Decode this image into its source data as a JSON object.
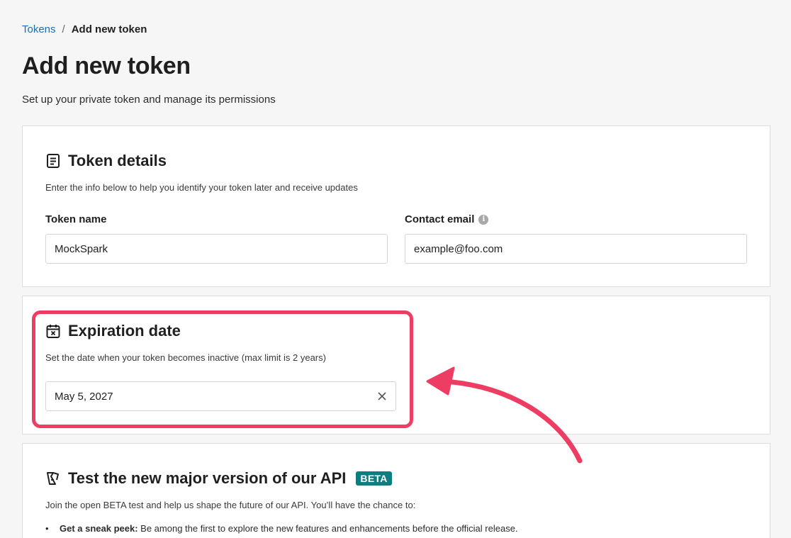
{
  "breadcrumb": {
    "parent": "Tokens",
    "separator": "/",
    "current": "Add new token"
  },
  "page": {
    "title": "Add new token",
    "subtitle": "Set up your private token and manage its permissions"
  },
  "token_details": {
    "icon": "document-icon",
    "title": "Token details",
    "description": "Enter the info below to help you identify your token later and receive updates",
    "token_name_label": "Token name",
    "token_name_value": "MockSpark",
    "contact_email_label": "Contact email",
    "contact_email_value": "example@foo.com"
  },
  "expiration": {
    "icon": "calendar-x-icon",
    "title": "Expiration date",
    "description": "Set the date when your token becomes inactive (max limit is 2 years)",
    "date_value": "May 5, 2027",
    "clear_icon": "close-icon"
  },
  "beta": {
    "icon": "flask-icon",
    "title": "Test the new major version of our API",
    "badge": "BETA",
    "description": "Join the open BETA test and help us shape the future of our API. You’ll have the chance to:",
    "bullets": [
      {
        "strong": "Get a sneak peek:",
        "text": " Be among the first to explore the new features and enhancements before the official release."
      }
    ]
  },
  "annotation": {
    "color": "#ee3d63"
  }
}
